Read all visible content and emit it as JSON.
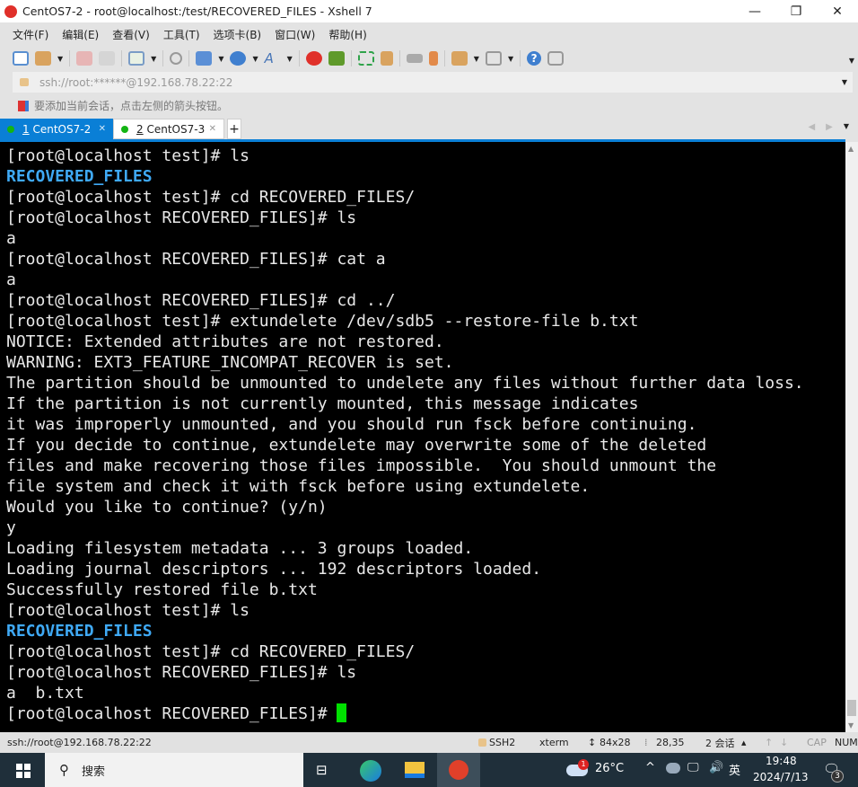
{
  "window": {
    "title": "CentOS7-2 - root@localhost:/test/RECOVERED_FILES - Xshell 7",
    "minimize": "—",
    "restore": "❐",
    "close": "✕"
  },
  "menu": [
    "文件(F)",
    "编辑(E)",
    "查看(V)",
    "工具(T)",
    "选项卡(B)",
    "窗口(W)",
    "帮助(H)"
  ],
  "address": {
    "value": "ssh://root:******@192.168.78.22:22"
  },
  "hint": "要添加当前会话，点击左侧的箭头按钮。",
  "tabs": [
    {
      "num": "1",
      "label": "CentOS7-2",
      "active": true
    },
    {
      "num": "2",
      "label": "CentOS7-3",
      "active": false
    }
  ],
  "tab_add": "+",
  "terminal": {
    "lines": [
      {
        "t": "[root@localhost test]# ls"
      },
      {
        "t": "RECOVERED_FILES",
        "dir": true
      },
      {
        "t": "[root@localhost test]# cd RECOVERED_FILES/"
      },
      {
        "t": "[root@localhost RECOVERED_FILES]# ls"
      },
      {
        "t": "a"
      },
      {
        "t": "[root@localhost RECOVERED_FILES]# cat a"
      },
      {
        "t": "a"
      },
      {
        "t": "[root@localhost RECOVERED_FILES]# cd ../"
      },
      {
        "t": "[root@localhost test]# extundelete /dev/sdb5 --restore-file b.txt"
      },
      {
        "t": "NOTICE: Extended attributes are not restored."
      },
      {
        "t": "WARNING: EXT3_FEATURE_INCOMPAT_RECOVER is set."
      },
      {
        "t": "The partition should be unmounted to undelete any files without further data loss."
      },
      {
        "t": "If the partition is not currently mounted, this message indicates"
      },
      {
        "t": "it was improperly unmounted, and you should run fsck before continuing."
      },
      {
        "t": "If you decide to continue, extundelete may overwrite some of the deleted"
      },
      {
        "t": "files and make recovering those files impossible.  You should unmount the"
      },
      {
        "t": "file system and check it with fsck before using extundelete."
      },
      {
        "t": "Would you like to continue? (y/n)"
      },
      {
        "t": "y"
      },
      {
        "t": "Loading filesystem metadata ... 3 groups loaded."
      },
      {
        "t": "Loading journal descriptors ... 192 descriptors loaded."
      },
      {
        "t": "Successfully restored file b.txt"
      },
      {
        "t": "[root@localhost test]# ls"
      },
      {
        "t": "RECOVERED_FILES",
        "dir": true
      },
      {
        "t": "[root@localhost test]# cd RECOVERED_FILES/"
      },
      {
        "t": "[root@localhost RECOVERED_FILES]# ls"
      },
      {
        "t": "a  b.txt"
      },
      {
        "t": "[root@localhost RECOVERED_FILES]# ",
        "cursor": true
      }
    ],
    "dir_color": "#3fa9f5",
    "cursor_color": "#00e000"
  },
  "status": {
    "connection": "ssh://root@192.168.78.22:22",
    "protocol": "SSH2",
    "term": "xterm",
    "size": "84x28",
    "cursor_pos": "28,35",
    "sessions": "2 会话",
    "cap": "CAP",
    "num": "NUM"
  },
  "taskbar": {
    "search": "搜索",
    "weather": "26°C",
    "weather_badge": "1",
    "ime": "英",
    "time": "19:48",
    "date": "2024/7/13",
    "notifications": "3"
  }
}
